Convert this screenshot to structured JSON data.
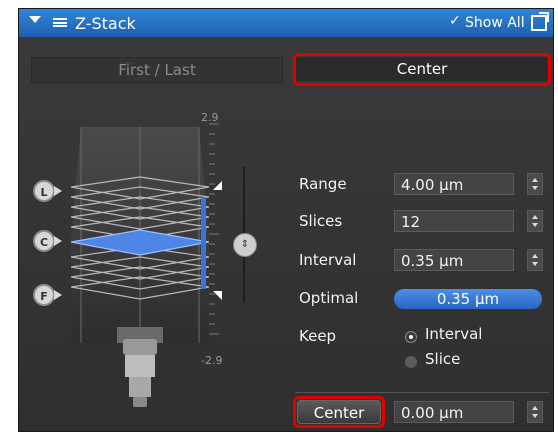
{
  "header": {
    "title": "Z-Stack",
    "show_all_label": "Show All",
    "colors": {
      "header_bg": "#2f86d8",
      "panel_bg": "#343434",
      "accent": "#3a74d8"
    }
  },
  "tabs": [
    {
      "label": "First / Last",
      "selected": false
    },
    {
      "label": "Center",
      "selected": true
    }
  ],
  "stack_view": {
    "scale_top": "2.9",
    "scale_bottom": "-2.9",
    "markers": [
      "L",
      "C",
      "F"
    ]
  },
  "settings": {
    "range": {
      "label": "Range",
      "value": "4.00 µm"
    },
    "slices": {
      "label": "Slices",
      "value": "12"
    },
    "interval": {
      "label": "Interval",
      "value": "0.35 µm"
    },
    "optimal": {
      "label": "Optimal",
      "value": "0.35 µm"
    },
    "keep": {
      "label": "Keep",
      "options": [
        {
          "label": "Interval",
          "selected": true
        },
        {
          "label": "Slice",
          "selected": false
        }
      ]
    }
  },
  "center_action": {
    "button_label": "Center",
    "value": "0.00 µm"
  }
}
